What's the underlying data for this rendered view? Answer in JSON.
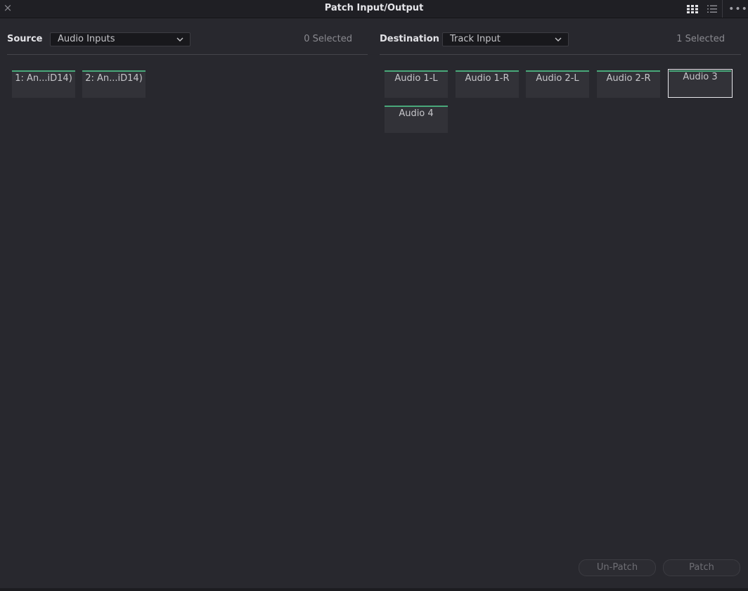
{
  "window": {
    "title": "Patch Input/Output",
    "close_glyph": "×",
    "menu_glyph": "•••"
  },
  "icons": {
    "close": "close-icon",
    "grid_view": "grid-view-icon",
    "list_view": "list-view-icon",
    "more": "more-options-icon",
    "dropdown": "chevron-down-icon"
  },
  "source": {
    "label": "Source",
    "dropdown_value": "Audio Inputs",
    "selected_count": "0 Selected",
    "tiles": [
      "1: An...iD14)",
      "2: An...iD14)"
    ]
  },
  "destination": {
    "label": "Destination",
    "dropdown_value": "Track Input",
    "selected_count": "1 Selected",
    "tiles": [
      "Audio 1-L",
      "Audio 1-R",
      "Audio 2-L",
      "Audio 2-R",
      "Audio 3",
      "Audio 4"
    ],
    "selected_tile": "Audio 3"
  },
  "actions": {
    "unpatch_label": "Un-Patch",
    "patch_label": "Patch"
  },
  "colors": {
    "background": "#28282e",
    "tile": "#323238",
    "accent_green": "#49a87a",
    "selected_outline": "#e8e8ec"
  }
}
